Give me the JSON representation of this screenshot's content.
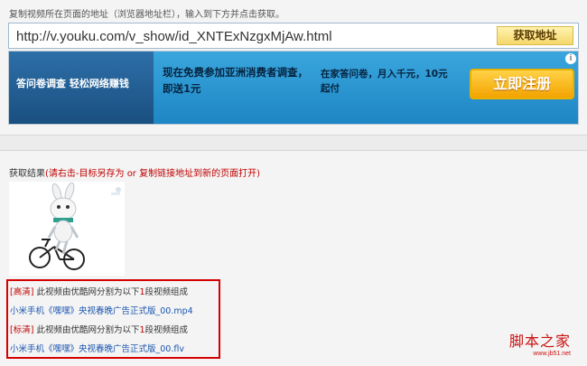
{
  "instruction": "复制视频所在页面的地址（浏览器地址栏），输入到下方并点击获取。",
  "url_input": {
    "value": "http://v.youku.com/v_show/id_XNTExNzgxMjAw.html"
  },
  "fetch_button": "获取地址",
  "ad": {
    "left_text": "答问卷调查 轻松网络赚钱",
    "text1": "现在免费参加亚洲消费者调查，即送1元",
    "text2": "在家答问卷，月入千元，10元起付",
    "register_button": "立即注册",
    "info_icon": "i"
  },
  "result": {
    "title": "获取结果",
    "hint": "(请右击-目标另存为 or 复制链接地址到新的页面打开)",
    "rows": [
      {
        "tag": "[高清]",
        "desc_prefix": " 此视频由优酷网分割为以下",
        "count": "1",
        "desc_suffix": "段视频组成"
      },
      {
        "link": "小米手机《嘿嘿》央视春晚广告正式版_00.mp4"
      },
      {
        "tag": "[标清]",
        "desc_prefix": " 此视频由优酷网分割为以下",
        "count": "1",
        "desc_suffix": "段视频组成"
      },
      {
        "link": "小米手机《嘿嘿》央视春晚广告正式版_00.flv"
      }
    ]
  },
  "watermark": {
    "main": "脚本之家",
    "sub": "www.jb51.net"
  },
  "icons": {
    "info": "info-icon",
    "thumbnail": "video-thumbnail"
  }
}
